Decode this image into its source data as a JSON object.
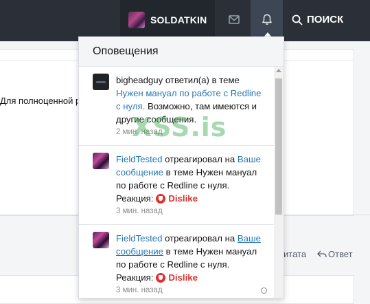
{
  "topbar": {
    "username": "SOLDATKIN",
    "search_label": "ПОИСК",
    "icons": [
      "envelope-icon",
      "bell-icon",
      "search-icon"
    ]
  },
  "background": {
    "text_fragment": "Для полноценной р",
    "quote_label": "итата",
    "reply_label": "Ответ"
  },
  "popup": {
    "title": "Оповещения",
    "alerts": [
      {
        "user": "bigheadguy",
        "action": " ответил(а) в теме",
        "thread": "Нужен мануал по работе с Redline с нуля.",
        "snippet": " Возможно, там имеются и другие сообщения.",
        "time": "2 мин. назад"
      },
      {
        "user": "FieldTested",
        "action": " отреагировал на ",
        "content_link": "Ваше сообщение",
        "middle": " в теме ",
        "thread": "Нужен мануал по работе с Redline с нуля.",
        "reaction_label": "Реакция:",
        "reaction": "Dislike",
        "time": "3 мин. назад"
      },
      {
        "user": "FieldTested",
        "action": " отреагировал на ",
        "content_link": "Ваше сообщение",
        "middle": " в теме ",
        "thread": "Нужен мануал по работе с Redline с нуля.",
        "reaction_label": "Реакция:",
        "reaction": "Dislike",
        "time": "3 мин. назад"
      }
    ]
  },
  "watermark": "XSS.is",
  "colors": {
    "topbar": "#2b3038",
    "active_tab": "#3d4654",
    "link": "#2577b1",
    "dislike": "#e03030"
  }
}
